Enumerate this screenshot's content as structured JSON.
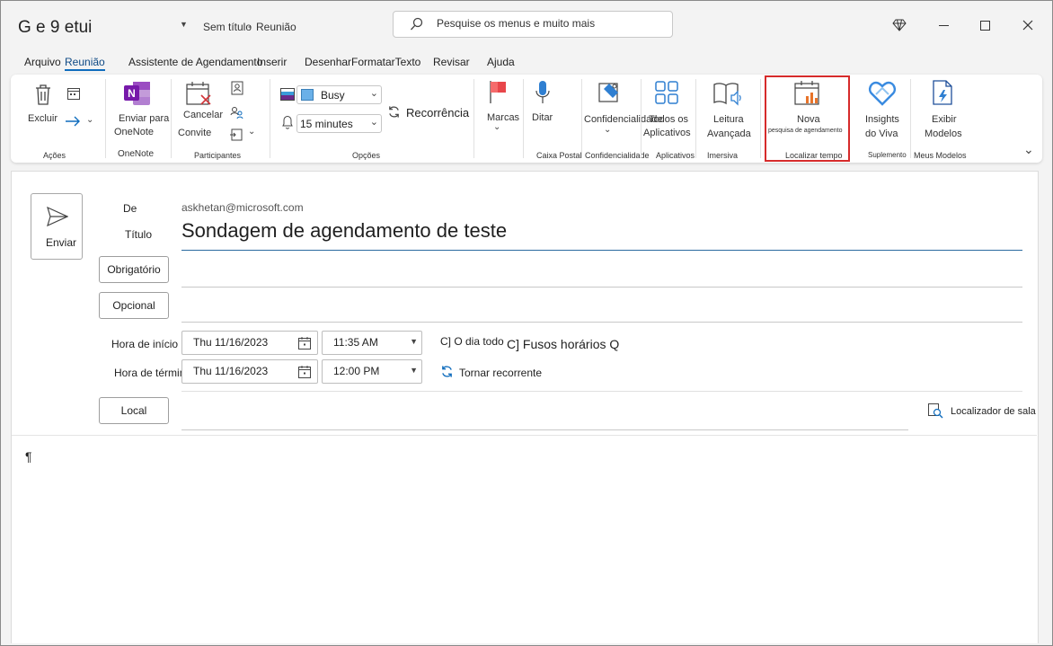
{
  "titlebar": {
    "app_title": "G e 9 etui",
    "doc_title": "Sem título",
    "mode": "Reunião",
    "search_placeholder": "Pesquise os menus e muito mais"
  },
  "menu": [
    "Arquivo",
    "Reunião",
    "Assistente de Agendamento",
    "Inserir",
    "Desenhar",
    "FormatarTexto",
    "Revisar",
    "Ajuda"
  ],
  "ribbon": {
    "delete": "Excluir",
    "send_onenote_1": "Enviar para",
    "send_onenote_2": "OneNote",
    "cancel_1": "Cancelar",
    "cancel_2": "Convite",
    "busy": "Busy",
    "reminder": "15 minutes",
    "recurrence": "Recorrência",
    "tags": "Marcas",
    "dictate": "Ditar",
    "sensitivity": "Confidencialidade",
    "all_apps_1": "Todos os",
    "all_apps_2": "Aplicativos",
    "reader_1": "Leitura",
    "reader_2": "Avançada",
    "new_poll_1": "Nova",
    "new_poll_2": "pesquisa de agendamento",
    "viva_1": "Insights",
    "viva_2": "do Viva",
    "templates_1": "Exibir",
    "templates_2": "Modelos",
    "groups": {
      "acoes": "Ações",
      "onenote": "OneNote",
      "participantes": "Participantes",
      "opcoes": "Opções",
      "caixa_postal": "Caixa Postal",
      "confidencialidade": "Confidencialidade",
      "aplicativos": "Aplicativos",
      "imersiva": "Imersiva",
      "localizar_tempo": "Localizar tempo",
      "suplemento": "Suplemento",
      "meus_modelos": "Meus Modelos"
    }
  },
  "form": {
    "send": "Enviar",
    "from_label": "De",
    "from_value": "askhetan@microsoft.com",
    "title_label": "Título",
    "title_value": "Sondagem de agendamento de teste",
    "required": "Obrigatório",
    "optional": "Opcional",
    "start_label": "Hora de início",
    "end_label": "Hora de término",
    "start_date": "Thu 11/16/2023",
    "start_time": "11:35 AM",
    "end_date": "Thu 11/16/2023",
    "end_time": "12:00 PM",
    "all_day": "C] O dia todo",
    "time_zones": "C] Fusos horários Q",
    "make_recurring": "Tornar recorrente",
    "location": "Local",
    "room_finder": "Localizador de sala",
    "body": "¶"
  },
  "colors": {
    "accent": "#0f6cbd",
    "highlight": "#d62b2b",
    "onenote": "#7719aa"
  }
}
